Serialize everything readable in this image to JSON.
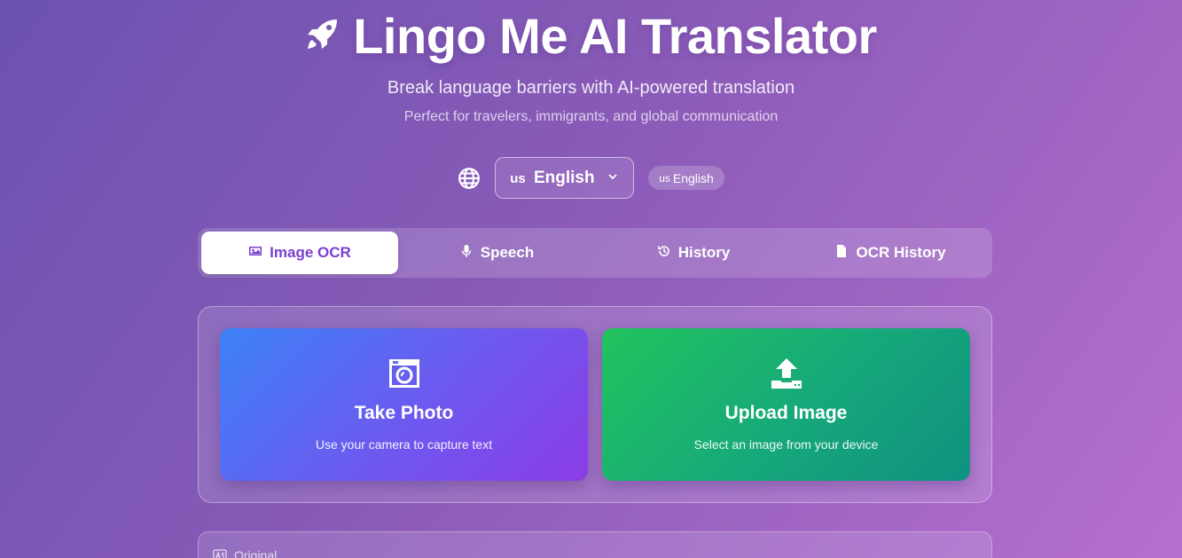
{
  "header": {
    "title": "Lingo Me AI Translator",
    "subtitle": "Break language barriers with AI-powered translation",
    "tagline": "Perfect for travelers, immigrants, and global communication",
    "logo_icon": "rocket-icon"
  },
  "language": {
    "icon": "globe-icon",
    "selected_code": "us",
    "selected_label": "English",
    "badge_code": "us",
    "badge_label": "English"
  },
  "tabs": [
    {
      "label": "Image OCR",
      "icon": "image-icon",
      "active": true
    },
    {
      "label": "Speech",
      "icon": "microphone-icon",
      "active": false
    },
    {
      "label": "History",
      "icon": "history-icon",
      "active": false
    },
    {
      "label": "OCR History",
      "icon": "file-icon",
      "active": false
    }
  ],
  "actions": {
    "take_photo": {
      "title": "Take Photo",
      "description": "Use your camera to capture text",
      "icon": "camera-icon"
    },
    "upload_image": {
      "title": "Upload Image",
      "description": "Select an image from your device",
      "icon": "upload-icon"
    }
  },
  "original": {
    "label": "Original",
    "icon": "language-icon"
  },
  "colors": {
    "accent": "#7b3fd1",
    "photo_start": "#3b82f6",
    "photo_end": "#8b3ce6",
    "upload_start": "#22c35e",
    "upload_end": "#0f9180"
  }
}
